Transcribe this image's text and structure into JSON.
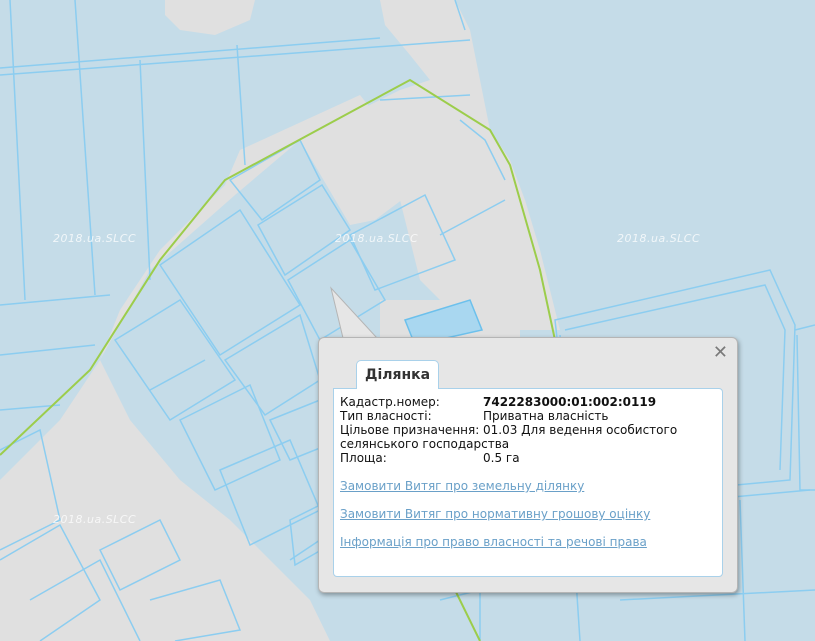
{
  "map": {
    "watermark": "2018.ua.SLCC",
    "colors": {
      "background": "#c5dce8",
      "parcel_fill": "#c5dce8",
      "parcel_stroke": "#8ccdf0",
      "road_fill": "#e0e0e0",
      "boundary_line": "#9ccd4b"
    }
  },
  "popup": {
    "tab_label": "Ділянка",
    "close_symbol": "✕",
    "cadastral_label": "Кадастр.номер:",
    "cadastral_value": "7422283000:01:002:0119",
    "ownership_label": "Тип власності:",
    "ownership_value": "Приватна власність",
    "purpose_label": "Цільове призначення:",
    "purpose_value": "01.03 Для ведення особистого",
    "purpose_value_cont": "селянського господарства",
    "area_label": "Площа:",
    "area_value": "0.5 га",
    "links": {
      "extract_parcel": "Замовити Витяг про земельну ділянку",
      "extract_valuation": "Замовити Витяг про нормативну грошову оцінку",
      "ownership_info": "Інформація про право власності та речові права"
    }
  }
}
